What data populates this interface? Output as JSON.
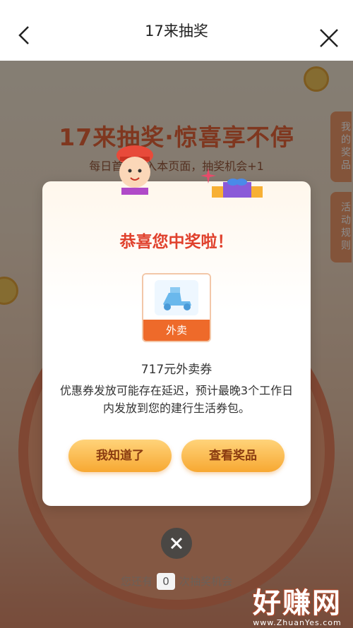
{
  "navbar": {
    "title": "17来抽奖"
  },
  "background": {
    "title": "17来抽奖·惊喜享不停",
    "subtitle": "每日首次进入本页面，抽奖机会+1",
    "tabs": {
      "prizes": "我的奖品",
      "rules": "活动规则"
    }
  },
  "modal": {
    "title": "恭喜您中奖啦！",
    "prize_icon_label": "外卖",
    "prize_name": "717元外卖券",
    "description": "优惠券发放可能存在延迟，预计最晚3个工作日内发放到您的建行生活券包。",
    "buttons": {
      "ok": "我知道了",
      "view": "查看奖品"
    }
  },
  "draws": {
    "prefix": "您还有",
    "count": "0",
    "suffix": "次抽奖机会"
  },
  "watermark": {
    "main": "好赚网",
    "url": "www.ZhuanYes.com"
  },
  "colors": {
    "accent": "#e0412d",
    "button": "#f7a832",
    "brand_orange": "#ee6a2a"
  }
}
